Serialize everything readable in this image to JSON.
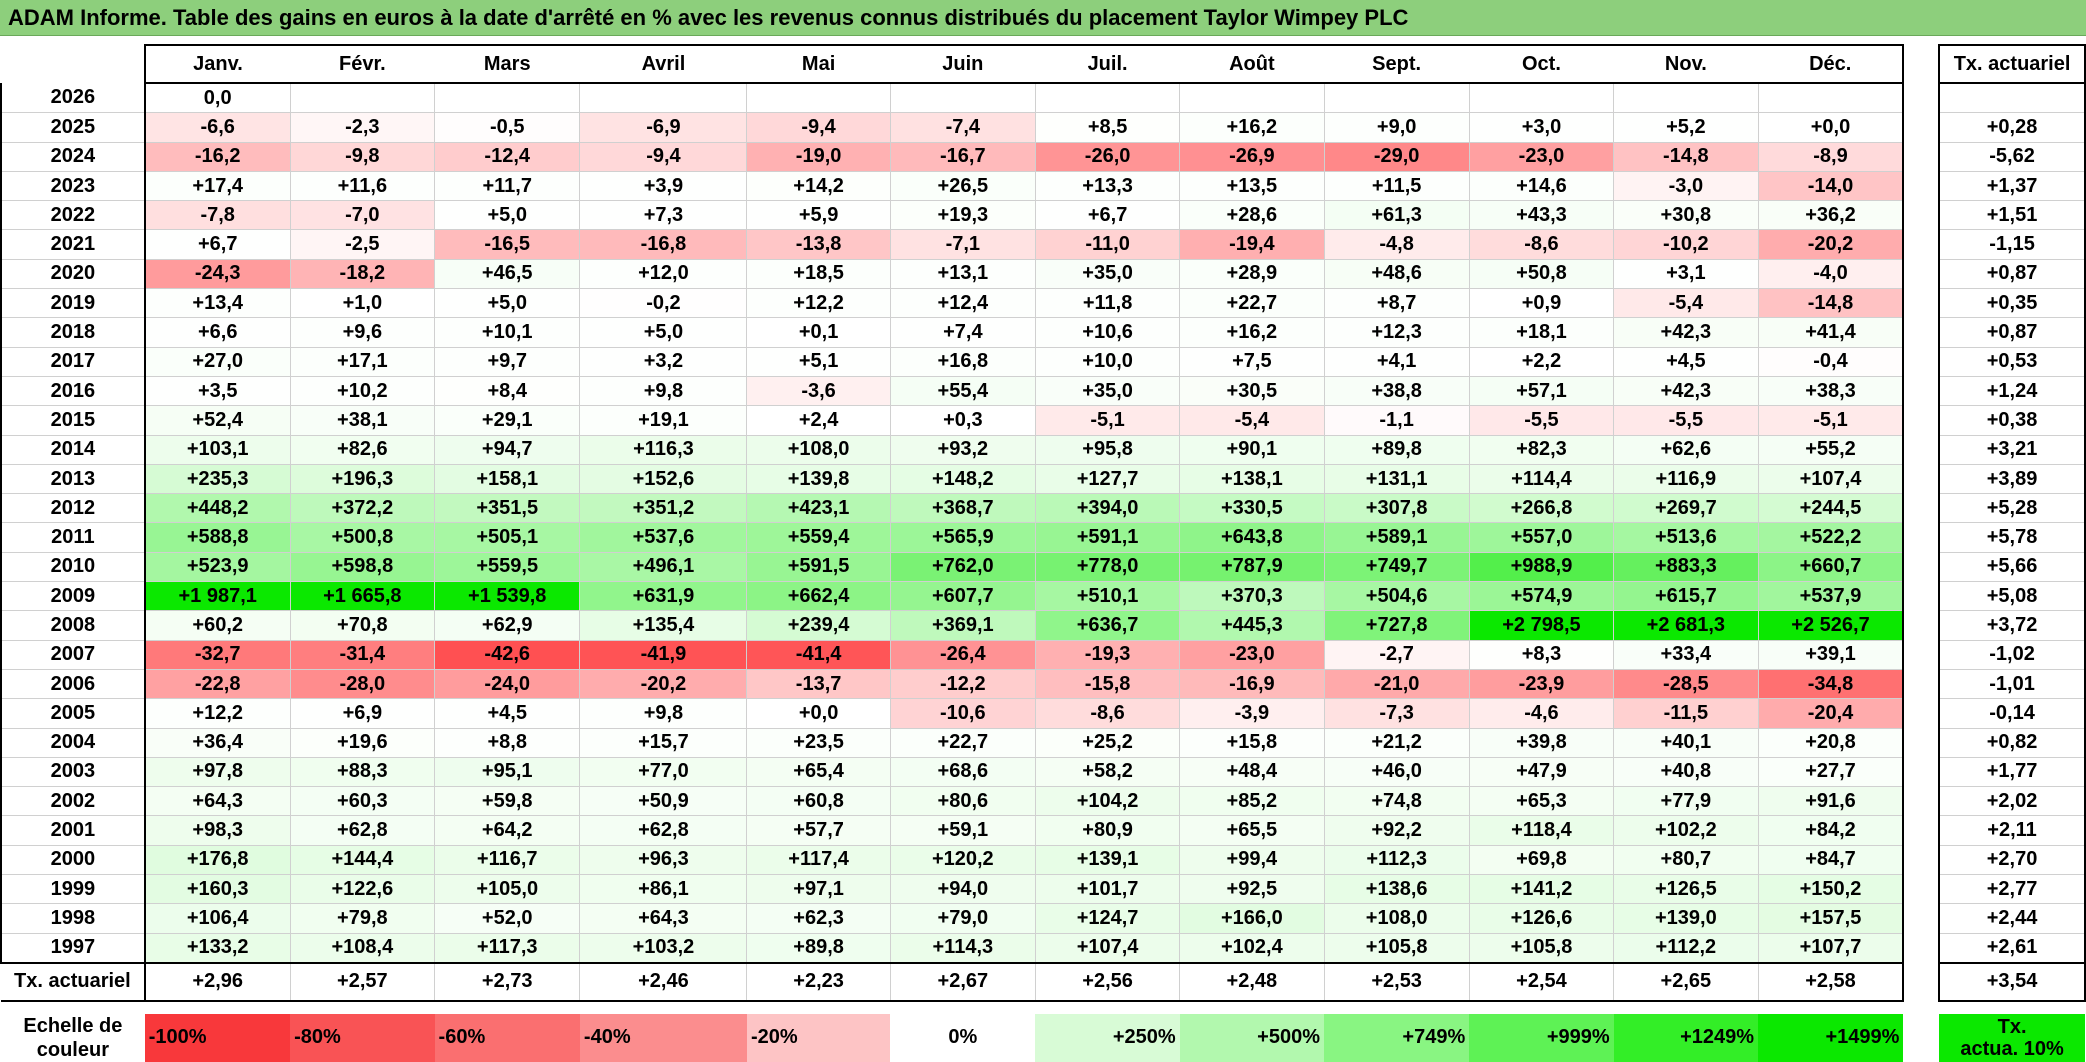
{
  "title": "ADAM Informe. Table des gains en euros à la date d'arrêté en % avec les revenus connus distribués du placement Taylor Wimpey PLC",
  "months": [
    "Janv.",
    "Févr.",
    "Mars",
    "Avril",
    "Mai",
    "Juin",
    "Juil.",
    "Août",
    "Sept.",
    "Oct.",
    "Nov.",
    "Déc."
  ],
  "rate_header": "Tx. actuariel",
  "rows": [
    {
      "year": "2026",
      "values": [
        "0,0",
        "",
        "",
        "",
        "",
        "",
        "",
        "",
        "",
        "",
        "",
        ""
      ],
      "rate": ""
    },
    {
      "year": "2025",
      "values": [
        "-6,6",
        "-2,3",
        "-0,5",
        "-6,9",
        "-9,4",
        "-7,4",
        "+8,5",
        "+16,2",
        "+9,0",
        "+3,0",
        "+5,2",
        "+0,0"
      ],
      "rate": "+0,28"
    },
    {
      "year": "2024",
      "values": [
        "-16,2",
        "-9,8",
        "-12,4",
        "-9,4",
        "-19,0",
        "-16,7",
        "-26,0",
        "-26,9",
        "-29,0",
        "-23,0",
        "-14,8",
        "-8,9"
      ],
      "rate": "-5,62"
    },
    {
      "year": "2023",
      "values": [
        "+17,4",
        "+11,6",
        "+11,7",
        "+3,9",
        "+14,2",
        "+26,5",
        "+13,3",
        "+13,5",
        "+11,5",
        "+14,6",
        "-3,0",
        "-14,0"
      ],
      "rate": "+1,37"
    },
    {
      "year": "2022",
      "values": [
        "-7,8",
        "-7,0",
        "+5,0",
        "+7,3",
        "+5,9",
        "+19,3",
        "+6,7",
        "+28,6",
        "+61,3",
        "+43,3",
        "+30,8",
        "+36,2"
      ],
      "rate": "+1,51"
    },
    {
      "year": "2021",
      "values": [
        "+6,7",
        "-2,5",
        "-16,5",
        "-16,8",
        "-13,8",
        "-7,1",
        "-11,0",
        "-19,4",
        "-4,8",
        "-8,6",
        "-10,2",
        "-20,2"
      ],
      "rate": "-1,15"
    },
    {
      "year": "2020",
      "values": [
        "-24,3",
        "-18,2",
        "+46,5",
        "+12,0",
        "+18,5",
        "+13,1",
        "+35,0",
        "+28,9",
        "+48,6",
        "+50,8",
        "+3,1",
        "-4,0"
      ],
      "rate": "+0,87"
    },
    {
      "year": "2019",
      "values": [
        "+13,4",
        "+1,0",
        "+5,0",
        "-0,2",
        "+12,2",
        "+12,4",
        "+11,8",
        "+22,7",
        "+8,7",
        "+0,9",
        "-5,4",
        "-14,8"
      ],
      "rate": "+0,35"
    },
    {
      "year": "2018",
      "values": [
        "+6,6",
        "+9,6",
        "+10,1",
        "+5,0",
        "+0,1",
        "+7,4",
        "+10,6",
        "+16,2",
        "+12,3",
        "+18,1",
        "+42,3",
        "+41,4"
      ],
      "rate": "+0,87"
    },
    {
      "year": "2017",
      "values": [
        "+27,0",
        "+17,1",
        "+9,7",
        "+3,2",
        "+5,1",
        "+16,8",
        "+10,0",
        "+7,5",
        "+4,1",
        "+2,2",
        "+4,5",
        "-0,4"
      ],
      "rate": "+0,53"
    },
    {
      "year": "2016",
      "values": [
        "+3,5",
        "+10,2",
        "+8,4",
        "+9,8",
        "-3,6",
        "+55,4",
        "+35,0",
        "+30,5",
        "+38,8",
        "+57,1",
        "+42,3",
        "+38,3"
      ],
      "rate": "+1,24"
    },
    {
      "year": "2015",
      "values": [
        "+52,4",
        "+38,1",
        "+29,1",
        "+19,1",
        "+2,4",
        "+0,3",
        "-5,1",
        "-5,4",
        "-1,1",
        "-5,5",
        "-5,5",
        "-5,1"
      ],
      "rate": "+0,38"
    },
    {
      "year": "2014",
      "values": [
        "+103,1",
        "+82,6",
        "+94,7",
        "+116,3",
        "+108,0",
        "+93,2",
        "+95,8",
        "+90,1",
        "+89,8",
        "+82,3",
        "+62,6",
        "+55,2"
      ],
      "rate": "+3,21"
    },
    {
      "year": "2013",
      "values": [
        "+235,3",
        "+196,3",
        "+158,1",
        "+152,6",
        "+139,8",
        "+148,2",
        "+127,7",
        "+138,1",
        "+131,1",
        "+114,4",
        "+116,9",
        "+107,4"
      ],
      "rate": "+3,89"
    },
    {
      "year": "2012",
      "values": [
        "+448,2",
        "+372,2",
        "+351,5",
        "+351,2",
        "+423,1",
        "+368,7",
        "+394,0",
        "+330,5",
        "+307,8",
        "+266,8",
        "+269,7",
        "+244,5"
      ],
      "rate": "+5,28"
    },
    {
      "year": "2011",
      "values": [
        "+588,8",
        "+500,8",
        "+505,1",
        "+537,6",
        "+559,4",
        "+565,9",
        "+591,1",
        "+643,8",
        "+589,1",
        "+557,0",
        "+513,6",
        "+522,2"
      ],
      "rate": "+5,78"
    },
    {
      "year": "2010",
      "values": [
        "+523,9",
        "+598,8",
        "+559,5",
        "+496,1",
        "+591,5",
        "+762,0",
        "+778,0",
        "+787,9",
        "+749,7",
        "+988,9",
        "+883,3",
        "+660,7"
      ],
      "rate": "+5,66"
    },
    {
      "year": "2009",
      "values": [
        "+1 987,1",
        "+1 665,8",
        "+1 539,8",
        "+631,9",
        "+662,4",
        "+607,7",
        "+510,1",
        "+370,3",
        "+504,6",
        "+574,9",
        "+615,7",
        "+537,9"
      ],
      "rate": "+5,08"
    },
    {
      "year": "2008",
      "values": [
        "+60,2",
        "+70,8",
        "+62,9",
        "+135,4",
        "+239,4",
        "+369,1",
        "+636,7",
        "+445,3",
        "+727,8",
        "+2 798,5",
        "+2 681,3",
        "+2 526,7"
      ],
      "rate": "+3,72"
    },
    {
      "year": "2007",
      "values": [
        "-32,7",
        "-31,4",
        "-42,6",
        "-41,9",
        "-41,4",
        "-26,4",
        "-19,3",
        "-23,0",
        "-2,7",
        "+8,3",
        "+33,4",
        "+39,1"
      ],
      "rate": "-1,02"
    },
    {
      "year": "2006",
      "values": [
        "-22,8",
        "-28,0",
        "-24,0",
        "-20,2",
        "-13,7",
        "-12,2",
        "-15,8",
        "-16,9",
        "-21,0",
        "-23,9",
        "-28,5",
        "-34,8"
      ],
      "rate": "-1,01"
    },
    {
      "year": "2005",
      "values": [
        "+12,2",
        "+6,9",
        "+4,5",
        "+9,8",
        "+0,0",
        "-10,6",
        "-8,6",
        "-3,9",
        "-7,3",
        "-4,6",
        "-11,5",
        "-20,4"
      ],
      "rate": "-0,14"
    },
    {
      "year": "2004",
      "values": [
        "+36,4",
        "+19,6",
        "+8,8",
        "+15,7",
        "+23,5",
        "+22,7",
        "+25,2",
        "+15,8",
        "+21,2",
        "+39,8",
        "+40,1",
        "+20,8"
      ],
      "rate": "+0,82"
    },
    {
      "year": "2003",
      "values": [
        "+97,8",
        "+88,3",
        "+95,1",
        "+77,0",
        "+65,4",
        "+68,6",
        "+58,2",
        "+48,4",
        "+46,0",
        "+47,9",
        "+40,8",
        "+27,7"
      ],
      "rate": "+1,77"
    },
    {
      "year": "2002",
      "values": [
        "+64,3",
        "+60,3",
        "+59,8",
        "+50,9",
        "+60,8",
        "+80,6",
        "+104,2",
        "+85,2",
        "+74,8",
        "+65,3",
        "+77,9",
        "+91,6"
      ],
      "rate": "+2,02"
    },
    {
      "year": "2001",
      "values": [
        "+98,3",
        "+62,8",
        "+64,2",
        "+62,8",
        "+57,7",
        "+59,1",
        "+80,9",
        "+65,5",
        "+92,2",
        "+118,4",
        "+102,2",
        "+84,2"
      ],
      "rate": "+2,11"
    },
    {
      "year": "2000",
      "values": [
        "+176,8",
        "+144,4",
        "+116,7",
        "+96,3",
        "+117,4",
        "+120,2",
        "+139,1",
        "+99,4",
        "+112,3",
        "+69,8",
        "+80,7",
        "+84,7"
      ],
      "rate": "+2,70"
    },
    {
      "year": "1999",
      "values": [
        "+160,3",
        "+122,6",
        "+105,0",
        "+86,1",
        "+97,1",
        "+94,0",
        "+101,7",
        "+92,5",
        "+138,6",
        "+141,2",
        "+126,5",
        "+150,2"
      ],
      "rate": "+2,77"
    },
    {
      "year": "1998",
      "values": [
        "+106,4",
        "+79,8",
        "+52,0",
        "+64,3",
        "+62,3",
        "+79,0",
        "+124,7",
        "+166,0",
        "+108,0",
        "+126,6",
        "+139,0",
        "+157,5"
      ],
      "rate": "+2,44"
    },
    {
      "year": "1997",
      "values": [
        "+133,2",
        "+108,4",
        "+117,3",
        "+103,2",
        "+89,8",
        "+114,3",
        "+107,4",
        "+102,4",
        "+105,8",
        "+105,8",
        "+112,2",
        "+107,7"
      ],
      "rate": "+2,61"
    }
  ],
  "totals": {
    "label": "Tx. actuariel",
    "values": [
      "+2,96",
      "+2,57",
      "+2,73",
      "+2,46",
      "+2,23",
      "+2,67",
      "+2,56",
      "+2,48",
      "+2,53",
      "+2,54",
      "+2,65",
      "+2,58"
    ],
    "rate": "+3,54"
  },
  "scale": {
    "label_line1": "Echelle de",
    "label_line2": "couleur",
    "items": [
      {
        "label": "-100%",
        "color": "#f8383b"
      },
      {
        "label": "-80%",
        "color": "#f95355"
      },
      {
        "label": "-60%",
        "color": "#fa6f70"
      },
      {
        "label": "-40%",
        "color": "#fb8d8e"
      },
      {
        "label": "-20%",
        "color": "#fdc4c5"
      },
      {
        "label": "0%",
        "color": "#ffffff"
      },
      {
        "label": "+250%",
        "color": "#d8fbd6"
      },
      {
        "label": "+500%",
        "color": "#b2f8ae"
      },
      {
        "label": "+749%",
        "color": "#89f582"
      },
      {
        "label": "+999%",
        "color": "#5ef255"
      },
      {
        "label": "+1249%",
        "color": "#33ee27"
      },
      {
        "label": "+1499%",
        "color": "#0be800"
      }
    ],
    "rate_line1": "Tx.",
    "rate_line2": "actua. 10%",
    "rate_color": "#0be800"
  },
  "colors": {
    "title_bg": "#8dcf7c",
    "max_green": "#0be800",
    "max_red": "#f8383b"
  }
}
